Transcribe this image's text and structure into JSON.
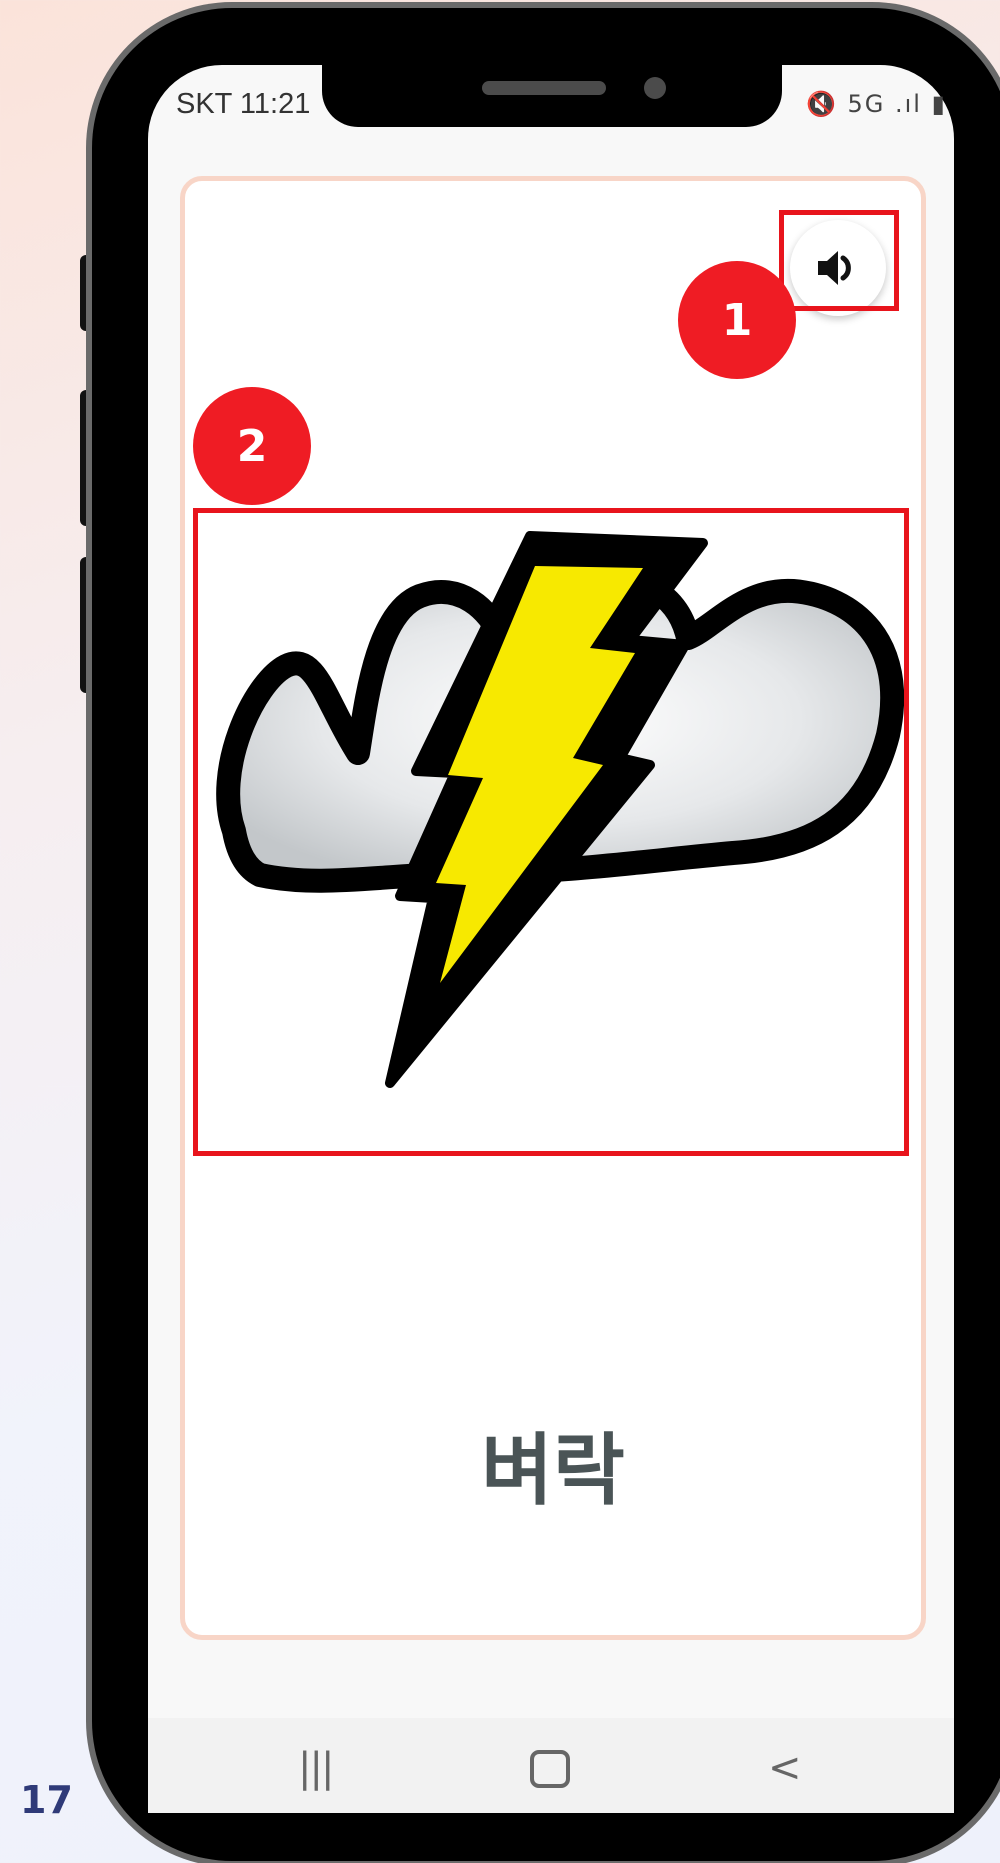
{
  "page_number": "17",
  "status_bar": {
    "time": "SKT 11:21",
    "icons": "🔇 5G .ıl ▮"
  },
  "card": {
    "sound_button_icon": "speaker-icon",
    "image_icon": "thunder-cloud-icon",
    "word": "벼락"
  },
  "callouts": {
    "first": "1",
    "second": "2"
  },
  "nav_bar": {
    "recents": "|||",
    "back": "<"
  },
  "colors": {
    "highlight": "#e8141c",
    "badge": "#ef1c24",
    "card_border": "#f8d5c7",
    "bolt_yellow": "#f7e900"
  }
}
